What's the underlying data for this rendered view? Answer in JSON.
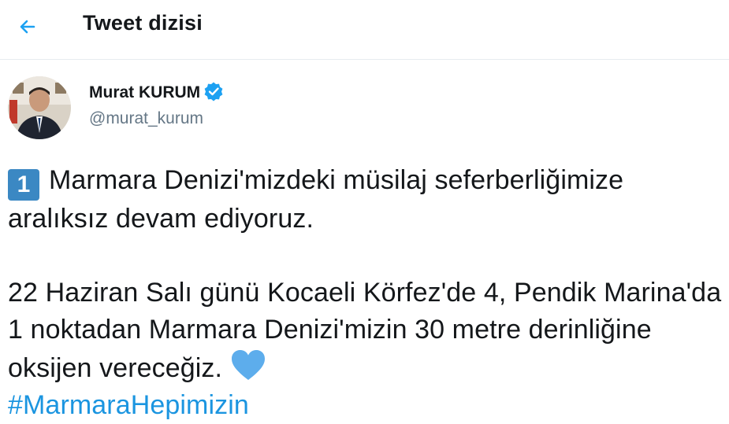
{
  "header": {
    "title": "Tweet dizisi",
    "back_icon": "arrow-left-icon"
  },
  "author": {
    "display_name": "Murat KURUM",
    "handle": "@murat_kurum",
    "verified_icon": "verified-badge-icon",
    "avatar": "avatar"
  },
  "tweet": {
    "keycap": "1",
    "line1": "Marmara Denizi'mizdeki müsilaj seferberliğimize aralıksız devam ediyoruz.",
    "line2a": "22 Haziran Salı günü Kocaeli Körfez'de 4, Pendik Marina'da 1 noktadan Marmara Denizi'mizin 30 metre derinliğine oksijen vereceğiz.",
    "heart_icon": "blue-heart-icon",
    "hashtag": "#MarmaraHepimizin"
  },
  "colors": {
    "accent": "#1da1f2",
    "hashtag": "#1b95e0",
    "text": "#14171a",
    "muted": "#657786",
    "keycap": "#3b88c3",
    "heart": "#5dadec"
  }
}
